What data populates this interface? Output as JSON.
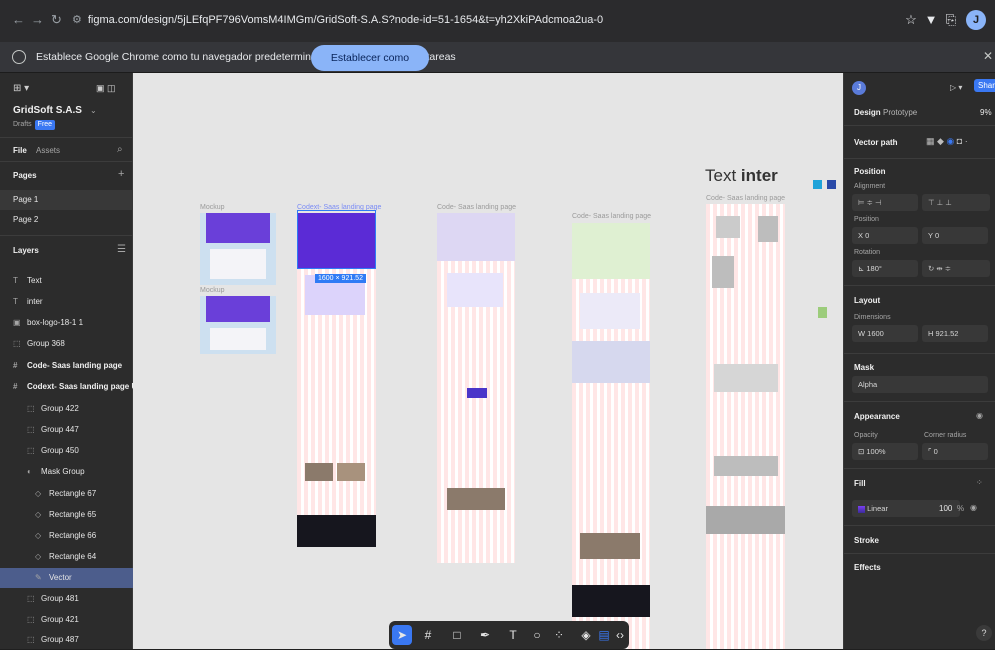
{
  "browser": {
    "url": "figma.com/design/5jLEfqPF796VomsM4IMGm/GridSoft-S.A.S?node-id=51-1654&t=yh2XkiPAdcmoa2ua-0",
    "infobar_text": "Establece Google Chrome como tu navegador predeterminado y fíjalo a la barra de tareas",
    "infobar_button": "Establecer como predeterminado",
    "avatar_letter": "J"
  },
  "left_panel": {
    "project_name": "GridSoft S.A.S",
    "drafts": "Drafts",
    "plan_badge": "Free",
    "tabs": {
      "file": "File",
      "assets": "Assets"
    },
    "pages_title": "Pages",
    "pages": [
      "Page 1",
      "Page 2"
    ],
    "layers_title": "Layers",
    "layers": [
      {
        "label": "Text",
        "icon": "text-icon"
      },
      {
        "label": "inter",
        "icon": "text-icon"
      },
      {
        "label": "box-logo-18-1 1",
        "icon": "image-icon"
      },
      {
        "label": "Group 368",
        "icon": "group-icon"
      },
      {
        "label": "Code- Saas landing page",
        "icon": "frame-icon"
      },
      {
        "label": "Codext- Saas landing page UI Design",
        "icon": "frame-icon"
      },
      {
        "label": "Group 422",
        "icon": "group-icon"
      },
      {
        "label": "Group 447",
        "icon": "group-icon"
      },
      {
        "label": "Group 450",
        "icon": "group-icon"
      },
      {
        "label": "Mask Group",
        "icon": "mask-icon"
      },
      {
        "label": "Rectangle 67",
        "icon": "rectangle-icon"
      },
      {
        "label": "Rectangle 65",
        "icon": "rectangle-icon"
      },
      {
        "label": "Rectangle 66",
        "icon": "rectangle-icon"
      },
      {
        "label": "Rectangle 64",
        "icon": "rectangle-icon"
      },
      {
        "label": "Vector",
        "icon": "vector-icon"
      },
      {
        "label": "Group 481",
        "icon": "group-icon"
      },
      {
        "label": "Group 421",
        "icon": "group-icon"
      },
      {
        "label": "Group 487",
        "icon": "group-icon"
      }
    ]
  },
  "canvas": {
    "mockup_label_1": "Mockup",
    "mockup_label_2": "Mockup",
    "frame1_label": "Codext- Saas landing page",
    "frame2_label": "Code- Saas landing page",
    "frame3_label": "Code- Saas landing page",
    "frame4_label": "Code- Saas landing page",
    "text_layer_regular": "Text",
    "text_layer_bold": "inter",
    "selection_size": "1600 × 921.52"
  },
  "right_panel": {
    "avatar_letter": "J",
    "share": "Share",
    "zoom": "9%",
    "tabs": {
      "design": "Design",
      "prototype": "Prototype"
    },
    "selection_type": "Vector path",
    "position_title": "Position",
    "alignment_label": "Alignment",
    "position_label": "Position",
    "x": "X  0",
    "y": "Y  0",
    "rotation_label": "Rotation",
    "rotation": "⊾ 180°",
    "layout_title": "Layout",
    "dimensions_label": "Dimensions",
    "w": "W  1600",
    "h": "H  921.52",
    "mask_title": "Mask",
    "mask_value": "Alpha",
    "appearance_title": "Appearance",
    "opacity_label": "Opacity",
    "opacity": "100%",
    "corner_label": "Corner radius",
    "corner": "0",
    "fill_title": "Fill",
    "fill_type": "Linear",
    "fill_opacity": "100",
    "fill_pct": "%",
    "stroke_title": "Stroke",
    "effects_title": "Effects",
    "help": "?"
  },
  "colors": {
    "accent": "#3a78f2",
    "hero_purple": "#5b2bd6",
    "canvas": "#e5e5e5",
    "panel": "#2c2c2c"
  }
}
